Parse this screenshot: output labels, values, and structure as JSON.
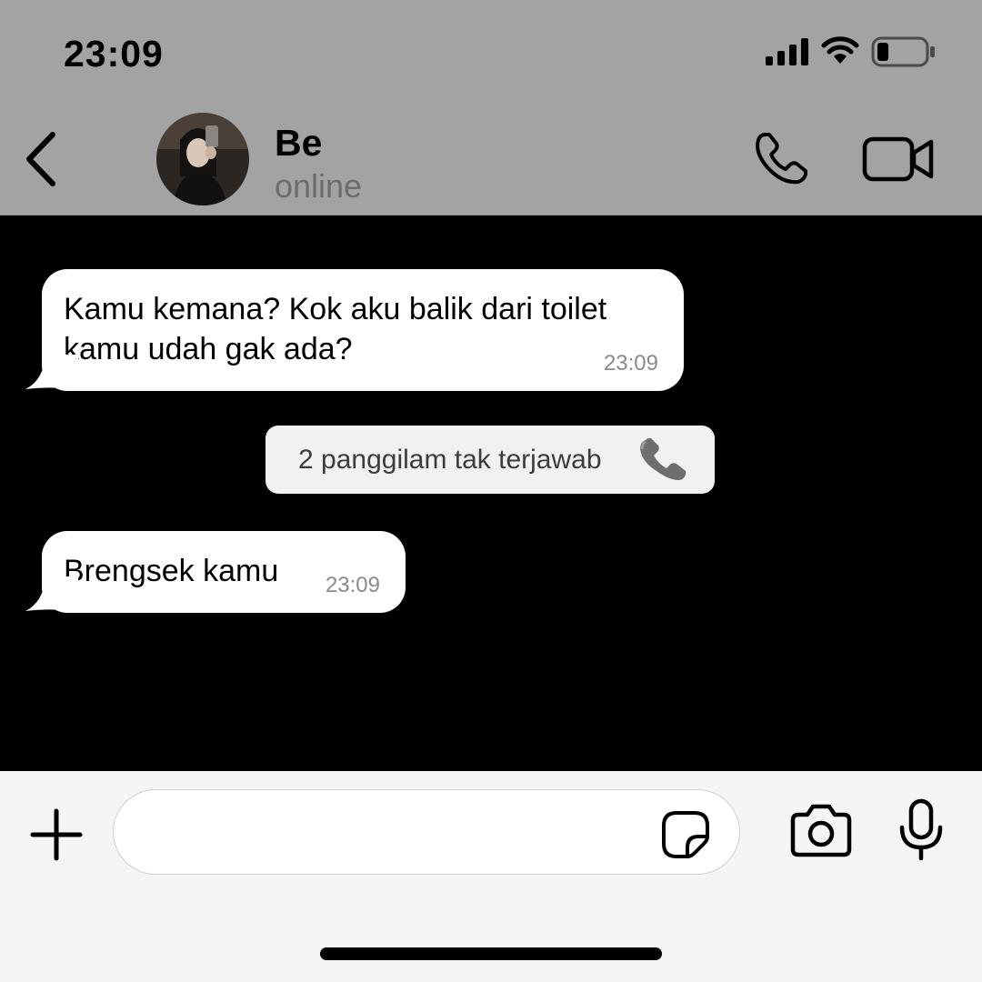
{
  "status_bar": {
    "time": "23:09",
    "icons": [
      "signal-icon",
      "wifi-icon",
      "battery-icon"
    ]
  },
  "chat_header": {
    "contact_name": "Be",
    "contact_status": "online",
    "icons": [
      "back-chevron-icon",
      "avatar",
      "phone-icon",
      "video-camera-icon"
    ]
  },
  "messages": [
    {
      "type": "incoming",
      "lines": [
        "Kamu kemana? Kok aku balik dari toilet",
        "kamu udah gak ada?"
      ],
      "time": "23:09"
    },
    {
      "type": "system",
      "text": "2 panggilam tak terjawab",
      "emoji": "📞"
    },
    {
      "type": "incoming",
      "lines": [
        "Brengsek kamu"
      ],
      "time": "23:09"
    }
  ],
  "input_bar": {
    "placeholder": "",
    "icons": [
      "plus-icon",
      "sticker-icon",
      "camera-icon",
      "microphone-icon"
    ]
  },
  "colors": {
    "header_bg": "#a3a3a3",
    "chat_bg": "#000000",
    "bubble_bg": "#ffffff",
    "input_bar_bg": "#f5f5f5"
  }
}
